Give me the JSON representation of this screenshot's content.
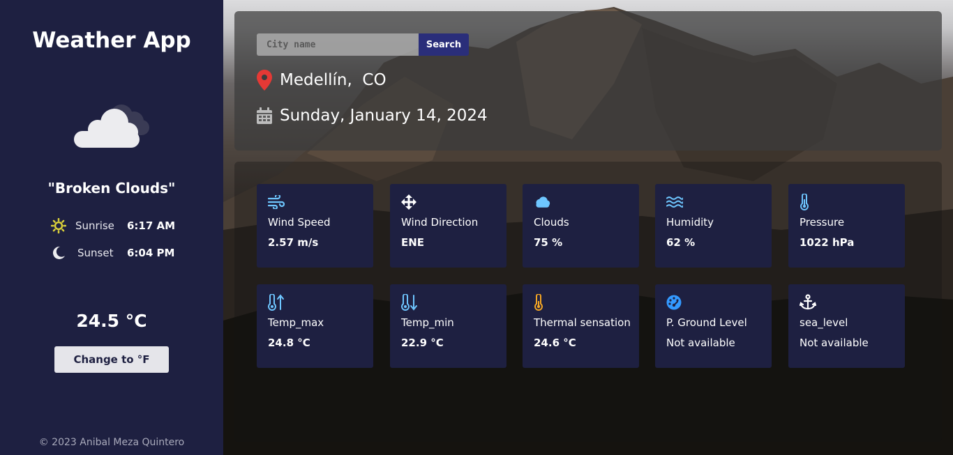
{
  "sidebar": {
    "title": "Weather App",
    "weather_icon": "broken-clouds-icon",
    "description": "\"Broken Clouds\"",
    "sunrise_label": "Sunrise",
    "sunrise_time": "6:17 AM",
    "sunset_label": "Sunset",
    "sunset_time": "6:04 PM",
    "temperature": "24.5 °C",
    "change_button": "Change to °F",
    "footer": "© 2023 Anibal Meza Quintero"
  },
  "search": {
    "placeholder": "City name",
    "value": "",
    "button": "Search"
  },
  "location": {
    "icon": "map-pin-icon",
    "text": "Medellín,  CO"
  },
  "date": {
    "icon": "calendar-icon",
    "text": "Sunday, January 14, 2024"
  },
  "cards": [
    {
      "icon": "wind-icon",
      "label": "Wind Speed",
      "value": "2.57 m/s"
    },
    {
      "icon": "arrows-move-icon",
      "label": "Wind Direction",
      "value": "ENE"
    },
    {
      "icon": "cloud-icon",
      "label": "Clouds",
      "value": "75 %"
    },
    {
      "icon": "water-waves-icon",
      "label": "Humidity",
      "value": "62 %"
    },
    {
      "icon": "thermometer-icon",
      "label": "Pressure",
      "value": "1022 hPa"
    },
    {
      "icon": "temp-up-icon",
      "label": "Temp_max",
      "value": "24.8 °C"
    },
    {
      "icon": "temp-down-icon",
      "label": "Temp_min",
      "value": "22.9 °C"
    },
    {
      "icon": "thermometer-half-icon",
      "label": "Thermal sensation",
      "value": "24.6 °C"
    },
    {
      "icon": "gauge-icon",
      "label": "P. Ground Level",
      "value": "Not available"
    },
    {
      "icon": "anchor-icon",
      "label": "sea_level",
      "value": "Not available"
    }
  ],
  "colors": {
    "sidebar_bg": "#1e2041",
    "card_bg": "#1e2041",
    "search_button": "#2a2e7a",
    "pin_red": "#e53935",
    "icon_blue": "#6ec6ff",
    "icon_orange": "#f5a623",
    "sun_yellow": "#d9cf3a"
  }
}
